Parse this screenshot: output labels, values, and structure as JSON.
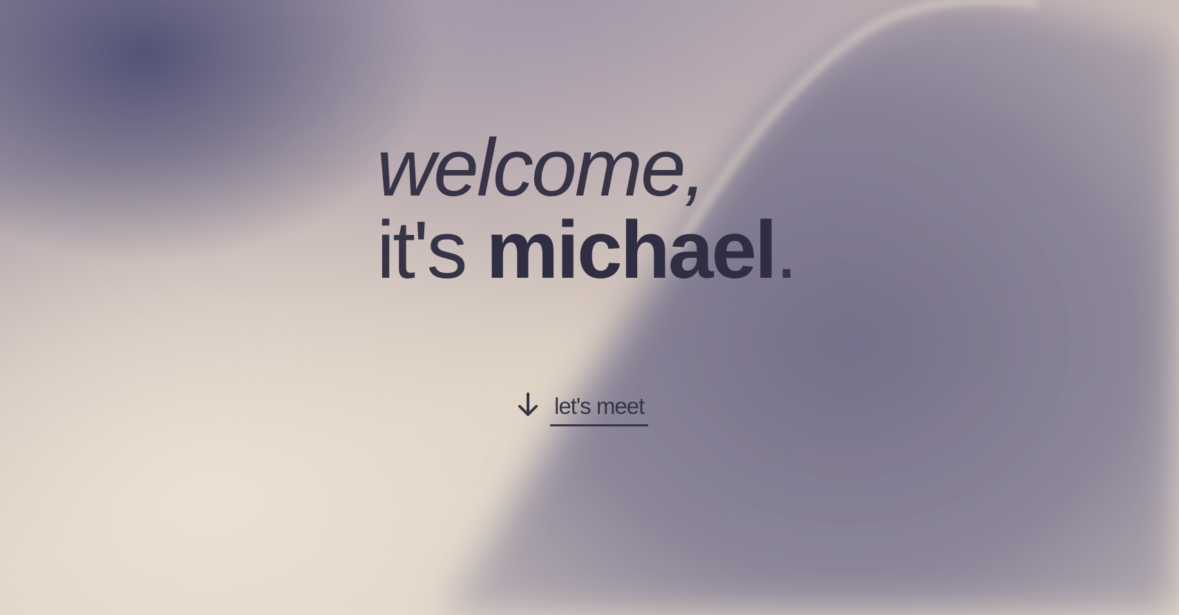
{
  "hero": {
    "greeting": "welcome,",
    "intro": "it's ",
    "name": "michael",
    "period": "."
  },
  "cta": {
    "label": "let's meet",
    "icon": "arrow-down-icon"
  },
  "colors": {
    "text": "#363446",
    "name": "#2f2e42",
    "background_light": "#e6dbcd",
    "background_dark": "#746f89"
  }
}
